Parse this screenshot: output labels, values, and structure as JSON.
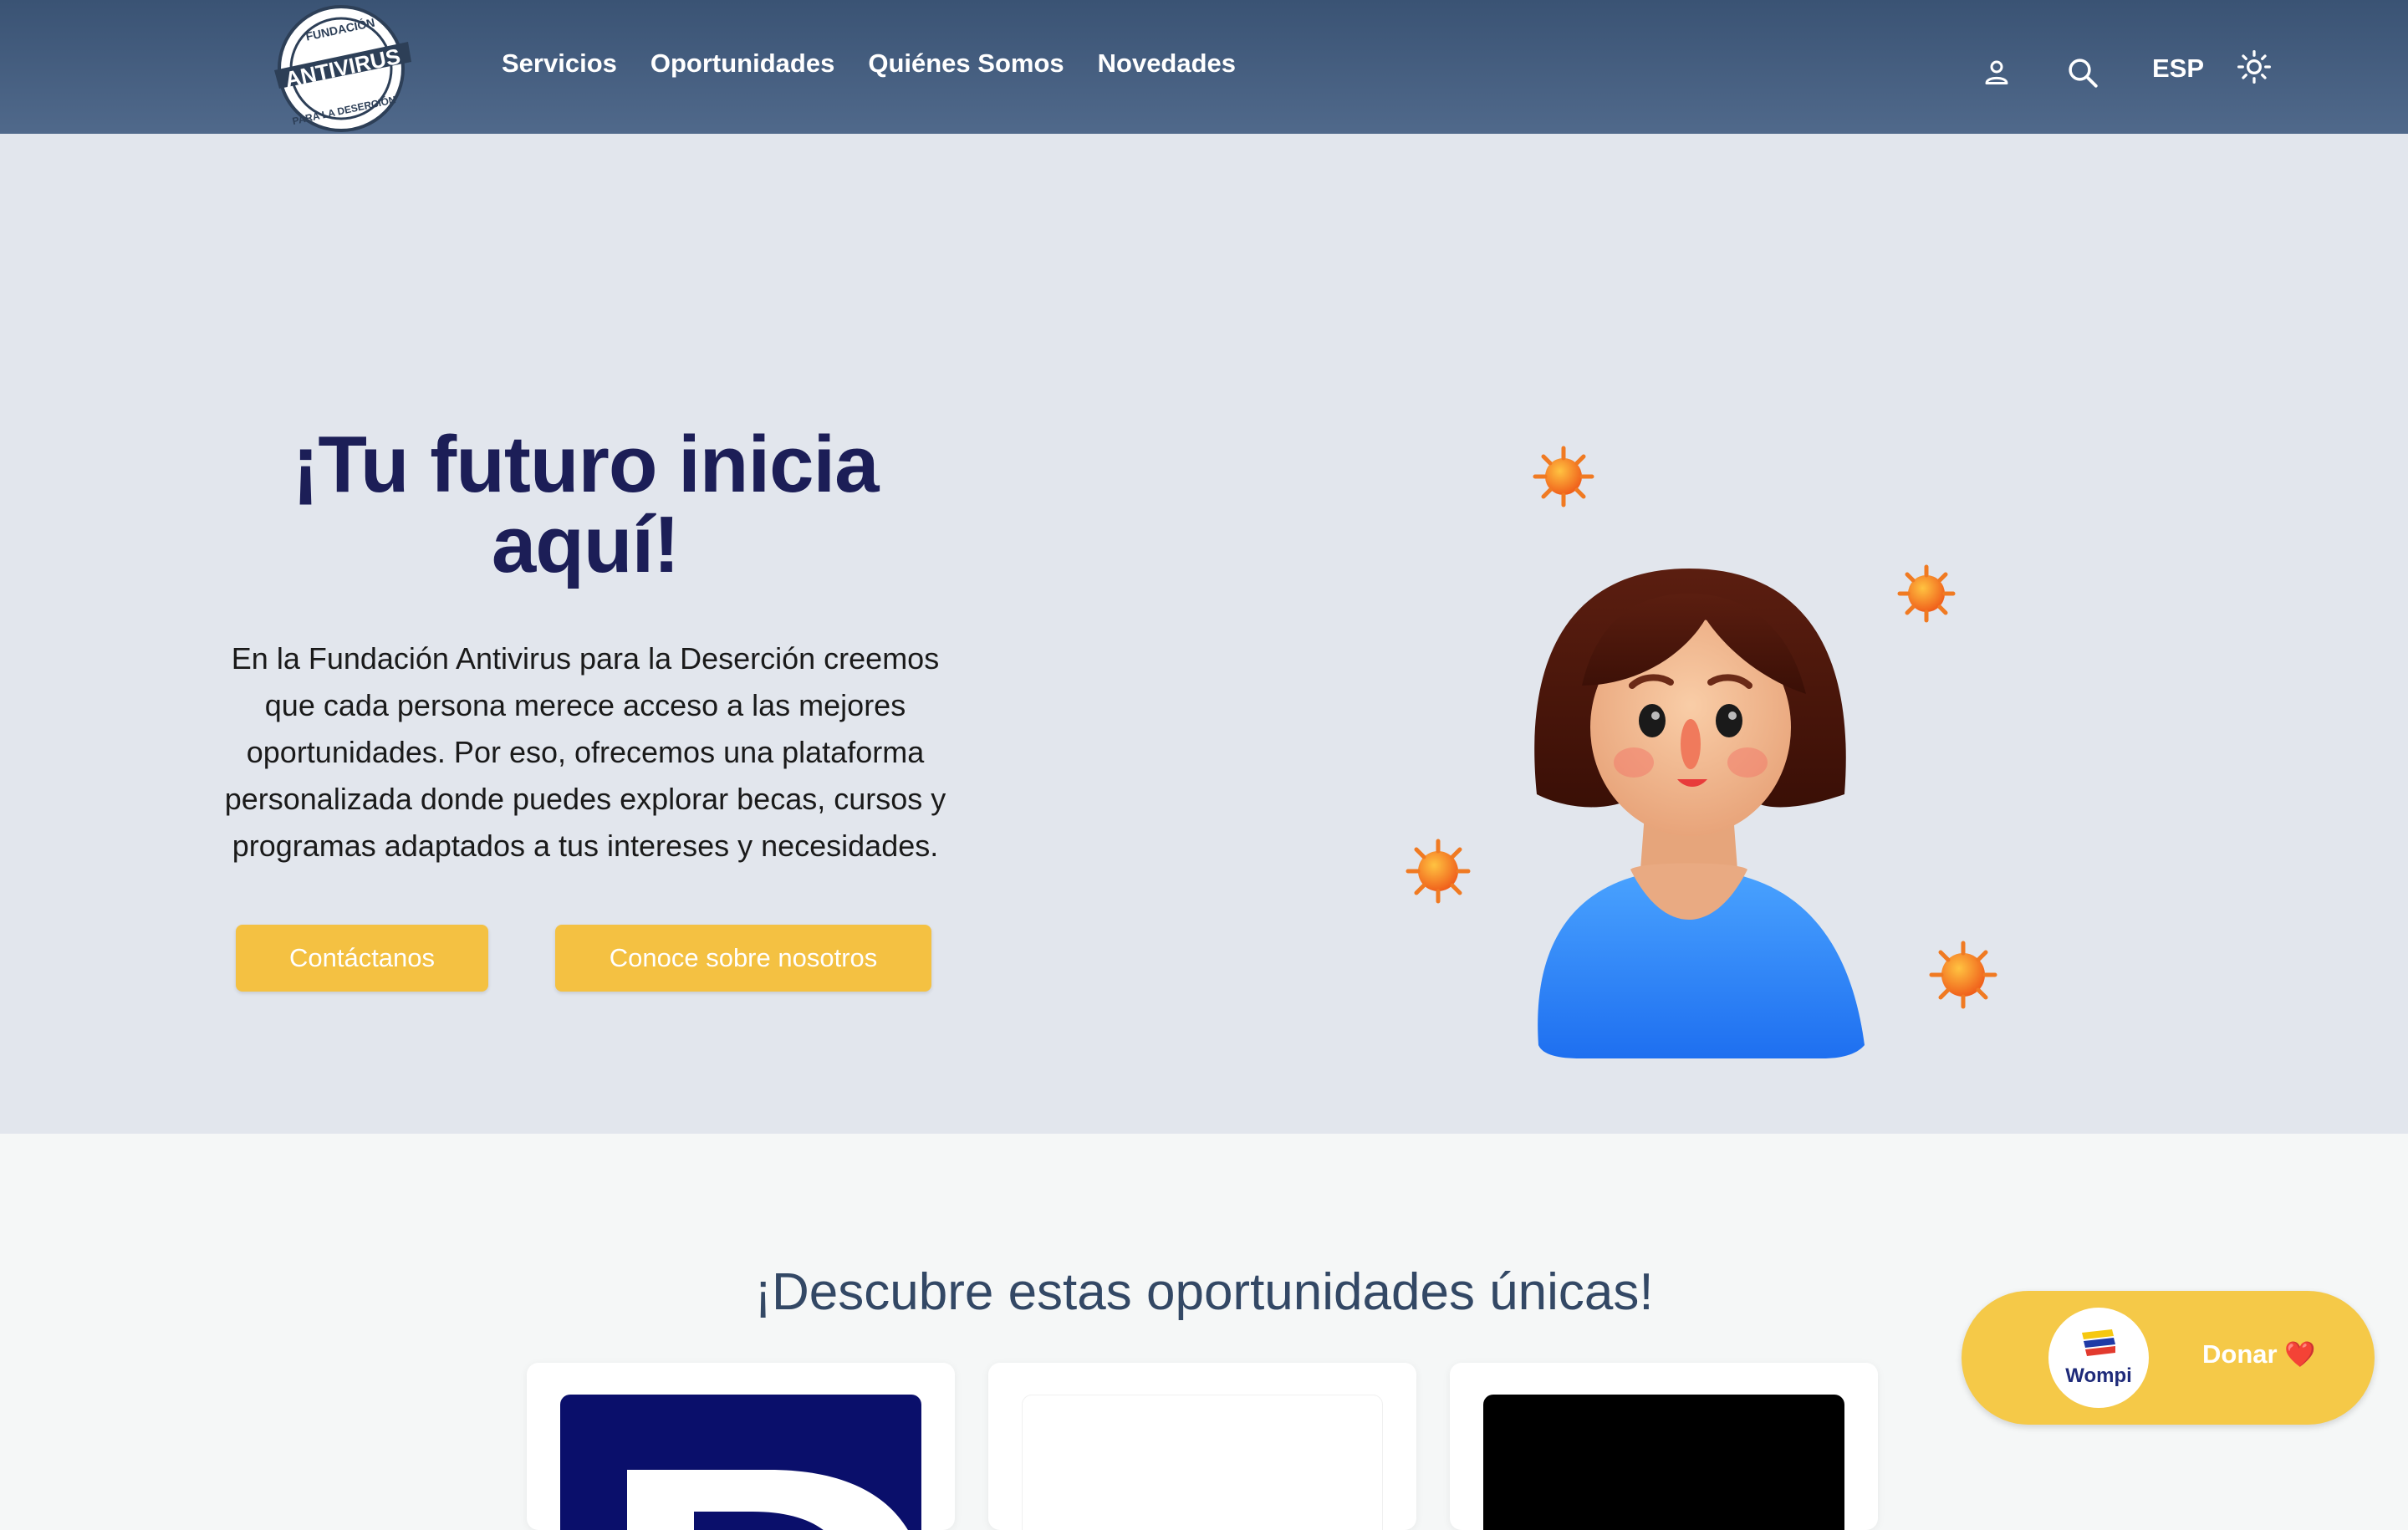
{
  "header": {
    "logo": {
      "top_text": "FUNDACIÓN",
      "main_text": "ANTIVIRUS",
      "bottom_text": "PARA LA DESERCIÓN"
    },
    "nav": [
      {
        "label": "Servicios"
      },
      {
        "label": "Oportunidades"
      },
      {
        "label": "Quiénes Somos"
      },
      {
        "label": "Novedades"
      }
    ],
    "language": "ESP",
    "icons": [
      "user-icon",
      "search-icon",
      "sun-icon"
    ]
  },
  "hero": {
    "title_line1": "¡Tu futuro inicia",
    "title_line2": "aquí!",
    "description": "En la Fundación Antivirus para la Deserción creemos que cada persona merece acceso a las mejores oportunidades. Por eso, ofrecemos una plataforma personalizada donde puedes explorar becas, cursos y programas adaptados a tus intereses y necesidades.",
    "buttons": {
      "contact": "Contáctanos",
      "about": "Conoce sobre nosotros"
    }
  },
  "opportunities": {
    "title": "¡Descubre estas oportunidades únicas!",
    "cards": [
      {
        "image": "navy-logo-image"
      },
      {
        "image": "blank-image"
      },
      {
        "image": "black-image"
      }
    ]
  },
  "donate": {
    "provider": "Wompi",
    "label": "Donar",
    "heart": "❤️"
  },
  "colors": {
    "header_top": "#3a5374",
    "header_bottom": "#50698b",
    "hero_bg": "#e2e6ed",
    "title": "#1c1e57",
    "button": "#f4c142",
    "section_title": "#334865"
  }
}
